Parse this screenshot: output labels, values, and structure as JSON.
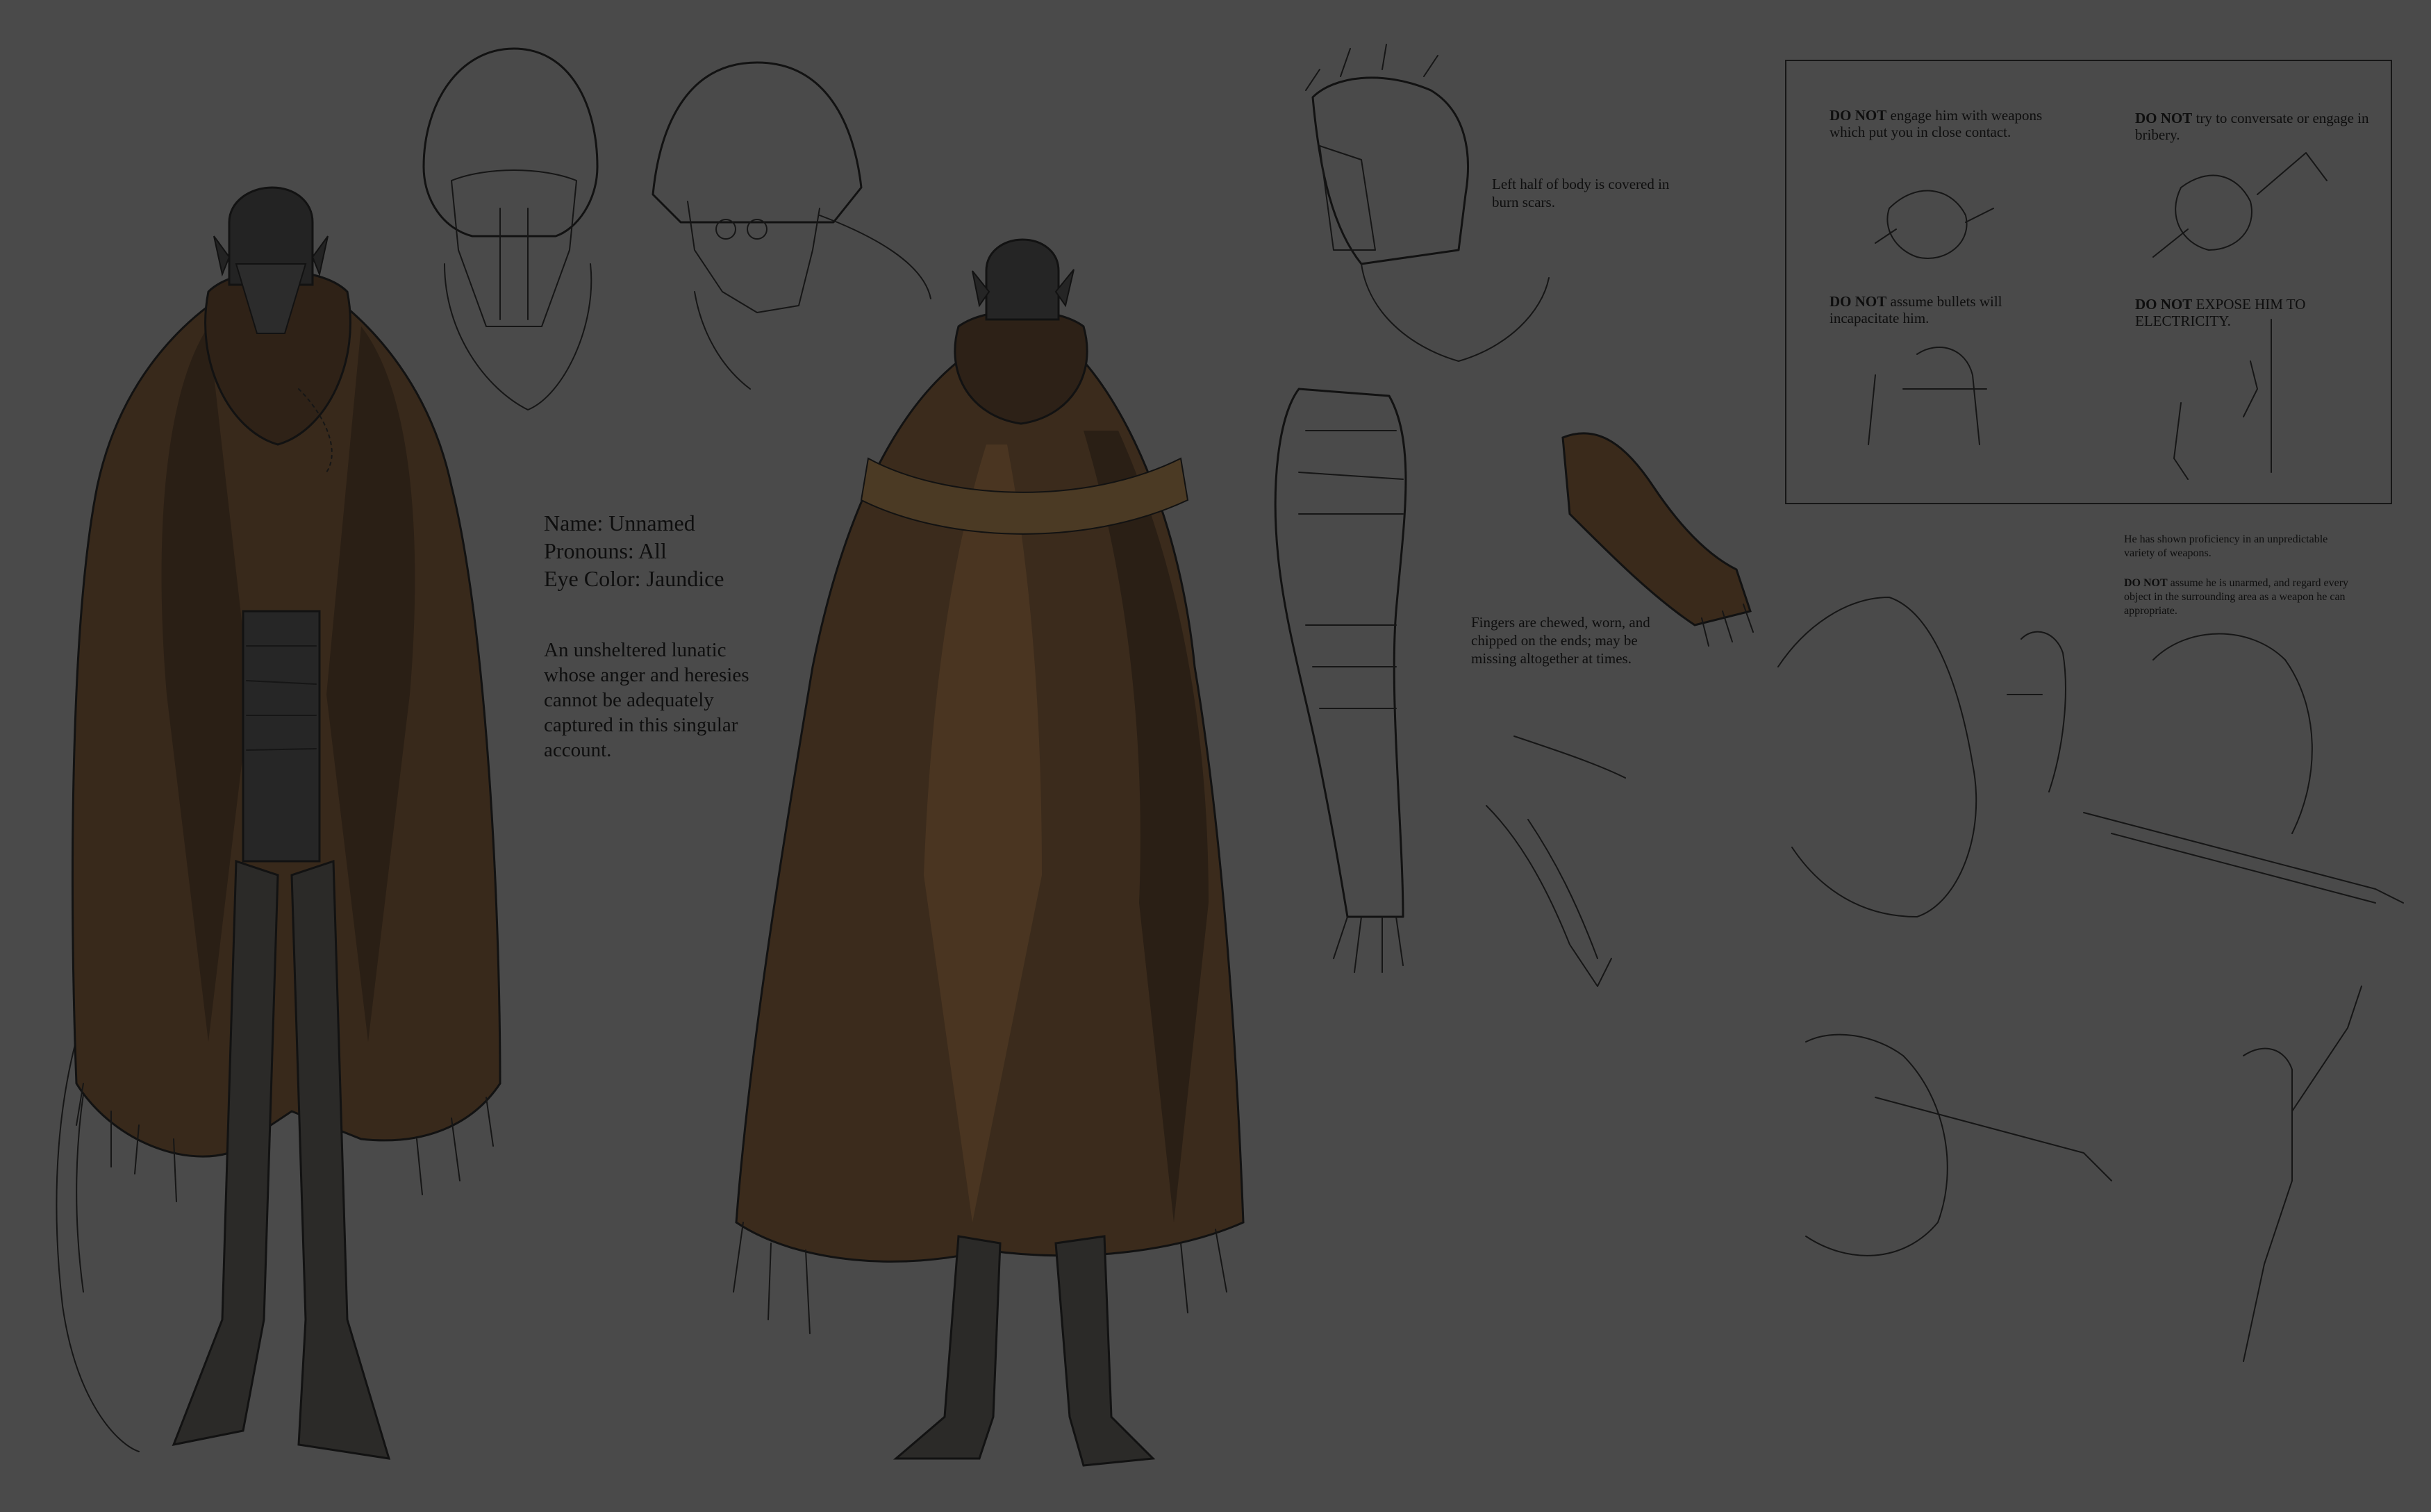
{
  "character": {
    "name_line": "Name: Unnamed",
    "pronouns_line": "Pronouns: All",
    "eye_color_line": "Eye Color: Jaundice",
    "description": "An unsheltered lunatic whose anger and heresies cannot be adequately captured in this singular account."
  },
  "notes": {
    "burn_scars": "Left half of body is covered in burn scars.",
    "fingers": "Fingers are chewed, worn, and chipped on the ends; may be missing altogether at times.",
    "proficiency": "He has shown proficiency in an unpredictable variety of weapons.",
    "unarmed_lead": "DO NOT",
    "unarmed_rest": " assume he is unarmed, and regard every object in the surrounding area as a weapon he can appropriate."
  },
  "warnings": [
    {
      "lead": "DO NOT",
      "rest": " engage him with weapons which put you in close contact."
    },
    {
      "lead": "DO NOT",
      "rest": " try to conversate or engage in bribery."
    },
    {
      "lead": "DO NOT",
      "rest": " assume bullets will incapacitate him."
    },
    {
      "lead": "DO NOT",
      "rest": " EXPOSE HIM TO ELECTRICITY."
    }
  ],
  "colors": {
    "background": "#4a4a4a",
    "ink": "#121212",
    "cloak_brown": "#3a2a1a",
    "cloak_dark": "#241c14",
    "helmet": "#232323"
  }
}
